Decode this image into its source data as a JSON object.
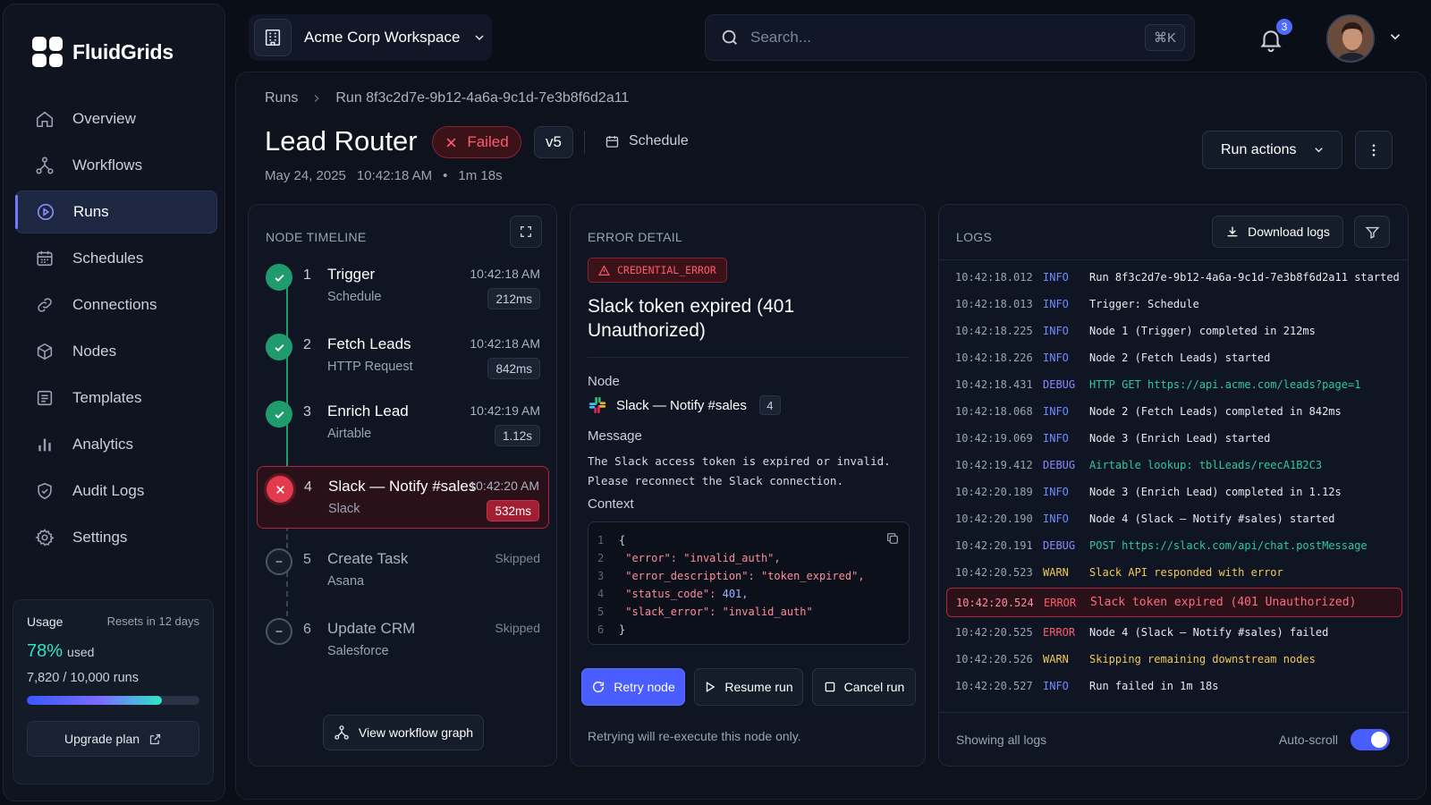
{
  "app": {
    "name": "FluidGrids"
  },
  "sidebar": {
    "items": [
      {
        "label": "Overview",
        "icon": "home-icon"
      },
      {
        "label": "Workflows",
        "icon": "workflow-icon"
      },
      {
        "label": "Runs",
        "icon": "play-circle-icon",
        "active": true
      },
      {
        "label": "Schedules",
        "icon": "calendar-icon"
      },
      {
        "label": "Connections",
        "icon": "link-icon"
      },
      {
        "label": "Nodes",
        "icon": "cube-icon"
      },
      {
        "label": "Templates",
        "icon": "template-icon"
      },
      {
        "label": "Analytics",
        "icon": "bar-chart-icon"
      },
      {
        "label": "Audit Logs",
        "icon": "shield-check-icon"
      },
      {
        "label": "Settings",
        "icon": "gear-icon"
      }
    ],
    "usage": {
      "title": "Usage",
      "resets": "Resets in 12 days",
      "percent": "78%",
      "used_label": "used",
      "used_fraction": 0.78,
      "runs": "7,820",
      "runs_sep": "/",
      "runs_total": "10,000 runs",
      "upgrade_label": "Upgrade plan"
    }
  },
  "topbar": {
    "workspace": "Acme Corp Workspace",
    "search_placeholder": "Search...",
    "shortcut": "⌘K",
    "notification_count": "3"
  },
  "breadcrumb": {
    "root": "Runs",
    "current": "Run 8f3c2d7e-9b12-4a6a-9c1d-7e3b8f6d2a11"
  },
  "run": {
    "title": "Lead Router",
    "status": "Failed",
    "version": "v5",
    "trigger": "Schedule",
    "date": "May 24, 2025",
    "time": "10:42:18 AM",
    "dot": "•",
    "duration": "1m 18s",
    "actions_label": "Run actions"
  },
  "timeline": {
    "header": "NODE TIMELINE",
    "nodes": [
      {
        "num": "1",
        "name": "Trigger",
        "sub": "Schedule",
        "time": "10:42:18 AM",
        "dur": "212ms",
        "state": "ok"
      },
      {
        "num": "2",
        "name": "Fetch Leads",
        "sub": "HTTP Request",
        "time": "10:42:18 AM",
        "dur": "842ms",
        "state": "ok"
      },
      {
        "num": "3",
        "name": "Enrich Lead",
        "sub": "Airtable",
        "time": "10:42:19 AM",
        "dur": "1.12s",
        "state": "ok"
      },
      {
        "num": "4",
        "name": "Slack — Notify #sales",
        "sub": "Slack",
        "time": "10:42:20 AM",
        "dur": "532ms",
        "state": "fail"
      },
      {
        "num": "5",
        "name": "Create Task",
        "sub": "Asana",
        "time": "Skipped",
        "dur": "",
        "state": "skip"
      },
      {
        "num": "6",
        "name": "Update CRM",
        "sub": "Salesforce",
        "time": "Skipped",
        "dur": "",
        "state": "skip"
      }
    ],
    "view_graph_label": "View workflow graph"
  },
  "error": {
    "header": "ERROR DETAIL",
    "code": "CREDENTIAL_ERROR",
    "title": "Slack token expired (401 Unauthorized)",
    "node_label": "Node",
    "node_name": "Slack — Notify #sales",
    "node_num": "4",
    "message_label": "Message",
    "message_line1": "The Slack access token is expired or invalid.",
    "message_line2": "Please reconnect the Slack connection.",
    "context_label": "Context",
    "context_lines": [
      {
        "n": "1",
        "k": "{",
        "v": "",
        "type": "p"
      },
      {
        "n": "2",
        "k": "\"error\": ",
        "v": "\"invalid_auth\",",
        "type": "s"
      },
      {
        "n": "3",
        "k": "\"error_description\": ",
        "v": "\"token_expired\",",
        "type": "s"
      },
      {
        "n": "4",
        "k": "\"status_code\": ",
        "v": "401,",
        "type": "n"
      },
      {
        "n": "5",
        "k": "\"slack_error\": ",
        "v": "\"invalid_auth\"",
        "type": "s"
      },
      {
        "n": "6",
        "k": "}",
        "v": "",
        "type": "p"
      }
    ],
    "retry_label": "Retry node",
    "resume_label": "Resume run",
    "cancel_label": "Cancel run",
    "retry_note": "Retrying will re-execute this node only."
  },
  "logs": {
    "header": "LOGS",
    "download_label": "Download logs",
    "rows": [
      {
        "t": "10:42:18.012",
        "lv": "INFO",
        "m": "Run 8f3c2d7e-9b12-4a6a-9c1d-7e3b8f6d2a11 started"
      },
      {
        "t": "10:42:18.013",
        "lv": "INFO",
        "m": "Trigger: Schedule"
      },
      {
        "t": "10:42:18.225",
        "lv": "INFO",
        "m": "Node 1 (Trigger) completed in 212ms"
      },
      {
        "t": "10:42:18.226",
        "lv": "INFO",
        "m": "Node 2 (Fetch Leads) started"
      },
      {
        "t": "10:42:18.431",
        "lv": "DEBUG",
        "m": "HTTP GET https://api.acme.com/leads?page=1"
      },
      {
        "t": "10:42:18.068",
        "lv": "INFO",
        "m": "Node 2 (Fetch Leads) completed in 842ms"
      },
      {
        "t": "10:42:19.069",
        "lv": "INFO",
        "m": "Node 3 (Enrich Lead) started"
      },
      {
        "t": "10:42:19.412",
        "lv": "DEBUG",
        "m": "Airtable lookup: tblLeads/reecA1B2C3"
      },
      {
        "t": "10:42:20.189",
        "lv": "INFO",
        "m": "Node 3 (Enrich Lead) completed in 1.12s"
      },
      {
        "t": "10:42:20.190",
        "lv": "INFO",
        "m": "Node 4 (Slack – Notify #sales) started"
      },
      {
        "t": "10:42:20.191",
        "lv": "DEBUG",
        "m": "POST https://slack.com/api/chat.postMessage"
      },
      {
        "t": "10:42:20.523",
        "lv": "WARN",
        "m": "Slack API responded with error"
      },
      {
        "t": "10:42:20.524",
        "lv": "ERROR",
        "m": "Slack token expired (401 Unauthorized)",
        "highlight": true
      },
      {
        "t": "10:42:20.525",
        "lv": "ERROR",
        "m": "Node 4 (Slack – Notify #sales) failed"
      },
      {
        "t": "10:42:20.526",
        "lv": "WARN",
        "m": "Skipping remaining downstream nodes"
      },
      {
        "t": "10:42:20.527",
        "lv": "INFO",
        "m": "Run failed in 1m 18s"
      }
    ],
    "footer_label": "Showing all logs",
    "autoscroll_label": "Auto-scroll",
    "autoscroll_on": true
  },
  "colors": {
    "accent": "#4a5dff",
    "success": "#1f9b6e",
    "error": "#e23a4f",
    "teal": "#2ee6c8"
  }
}
